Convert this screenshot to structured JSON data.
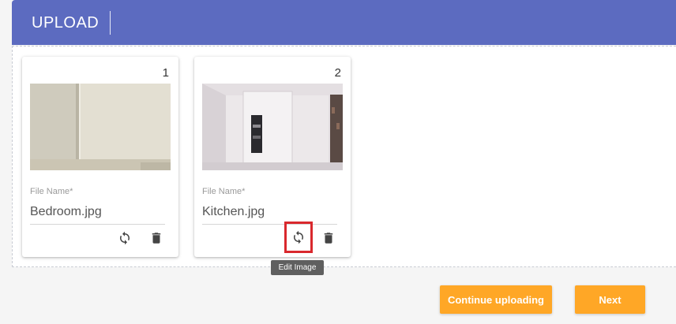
{
  "header": {
    "title": "UPLOAD"
  },
  "cards": [
    {
      "index": "1",
      "field_label": "File Name",
      "required_mark": "*",
      "file_name": "Bedroom.jpg",
      "actions": {
        "replace_icon": "replace-icon",
        "delete_icon": "trash-icon"
      }
    },
    {
      "index": "2",
      "field_label": "File Name",
      "required_mark": "*",
      "file_name": "Kitchen.jpg",
      "actions": {
        "replace_icon": "replace-icon",
        "delete_icon": "trash-icon"
      }
    }
  ],
  "tooltip": {
    "text": "Edit Image"
  },
  "buttons": {
    "continue_label": "Continue uploading",
    "next_label": "Next"
  },
  "colors": {
    "header": "#5c6bc0",
    "button": "#ffa726",
    "highlight": "#d9282d"
  }
}
